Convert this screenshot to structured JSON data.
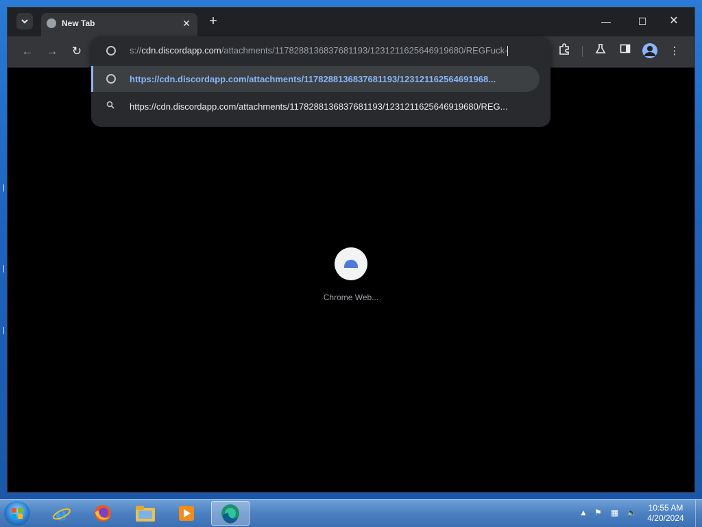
{
  "browser": {
    "tab_title": "New Tab",
    "address_prefix": "s://",
    "address_main": "cdn.discordapp.com",
    "address_rest": "/attachments/1178288136837681193/1231211625646919680/REGFuck-",
    "suggestions": [
      {
        "type": "url",
        "icon": "globe-icon",
        "text": "https://cdn.discordapp.com/attachments/1178288136837681193/123121162564691968..."
      },
      {
        "type": "search",
        "icon": "search-icon",
        "text": "https://cdn.discordapp.com/attachments/1178288136837681193/1231211625646919680/REG..."
      }
    ],
    "shortcut_label": "Chrome Web...",
    "accent_color": "#8ab4f8"
  },
  "taskbar": {
    "apps": [
      "internet-explorer-icon",
      "firefox-icon",
      "file-explorer-icon",
      "media-player-icon",
      "edge-icon"
    ],
    "time": "10:55 AM",
    "date": "4/20/2024"
  }
}
